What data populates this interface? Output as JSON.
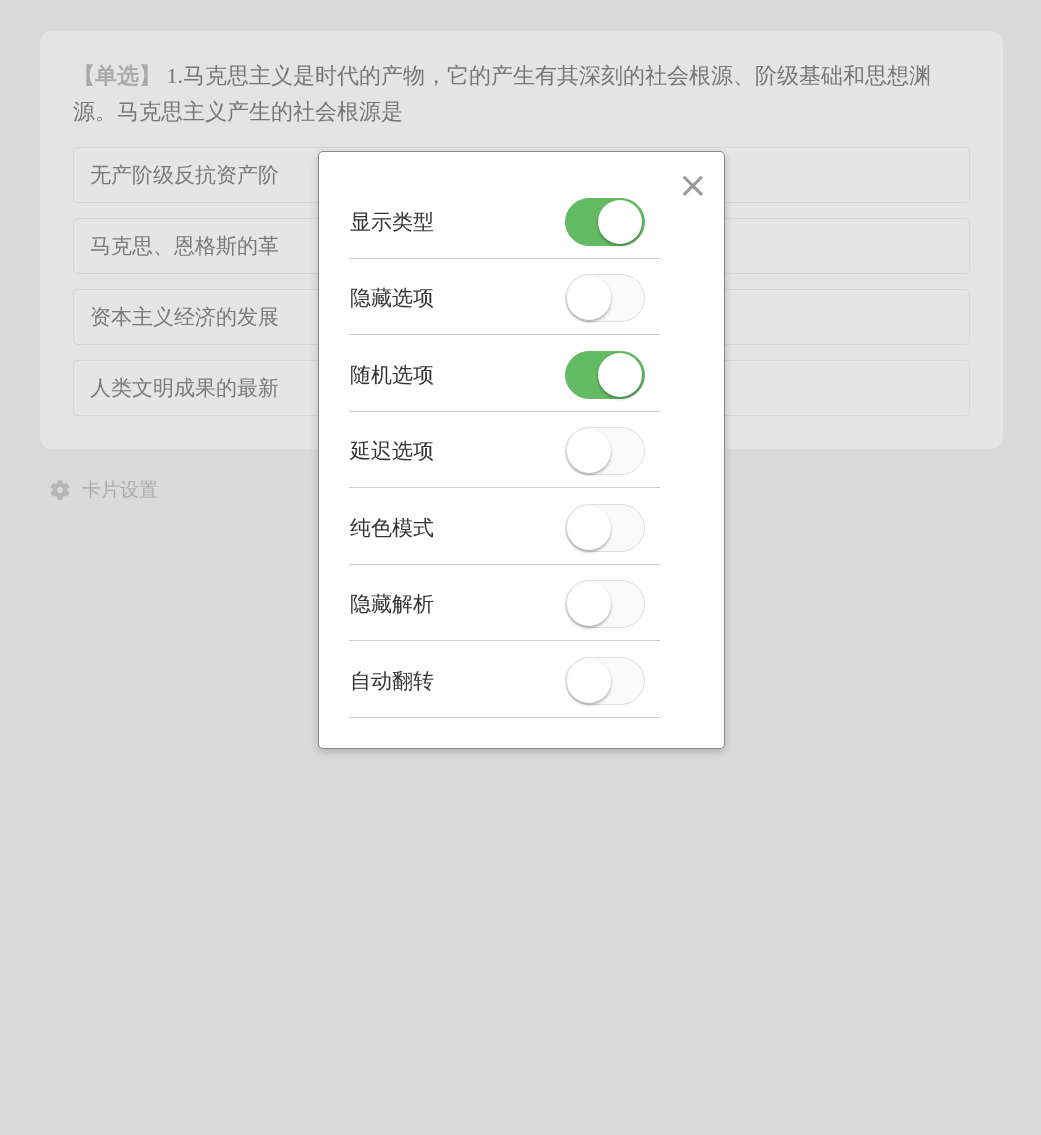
{
  "question": {
    "type_tag": "【单选】",
    "text": "1.马克思主义是时代的产物，它的产生有其深刻的社会根源、阶级基础和思想渊源。马克思主义产生的社会根源是"
  },
  "options": [
    "无产阶级反抗资产阶",
    "马克思、恩格斯的革",
    "资本主义经济的发展",
    "人类文明成果的最新"
  ],
  "card_settings": {
    "label": "卡片设置"
  },
  "settings_dialog": {
    "close_label": "×",
    "items": [
      {
        "label": "显示类型",
        "on": true
      },
      {
        "label": "隐藏选项",
        "on": false
      },
      {
        "label": "随机选项",
        "on": true
      },
      {
        "label": "延迟选项",
        "on": false
      },
      {
        "label": "纯色模式",
        "on": false
      },
      {
        "label": "隐藏解析",
        "on": false
      },
      {
        "label": "自动翻转",
        "on": false
      }
    ]
  }
}
